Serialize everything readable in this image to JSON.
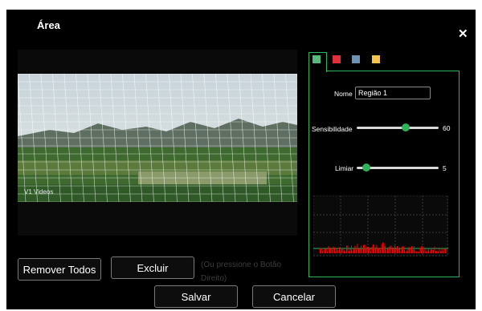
{
  "dialog": {
    "title": "Área",
    "close_icon": "close-icon"
  },
  "video": {
    "watermark": "V1 Videos"
  },
  "buttons": {
    "remove_all": "Remover Todos",
    "delete": "Excluir",
    "hint": "(Ou pressione o Botão Direito)",
    "save": "Salvar",
    "cancel": "Cancelar"
  },
  "tabs": [
    {
      "color": "#57b97e",
      "selected": true
    },
    {
      "color": "#e2303b",
      "selected": false
    },
    {
      "color": "#6f93b2",
      "selected": false
    },
    {
      "color": "#f2c44c",
      "selected": false
    }
  ],
  "region": {
    "name_label": "Nome",
    "name_value": "Região 1",
    "sensitivity_label": "Sensibilidade",
    "sensitivity_value": "60",
    "threshold_label": "Limiar",
    "threshold_value": "5"
  },
  "colors": {
    "accent": "#2fb35a",
    "activity": "#ff0000"
  }
}
